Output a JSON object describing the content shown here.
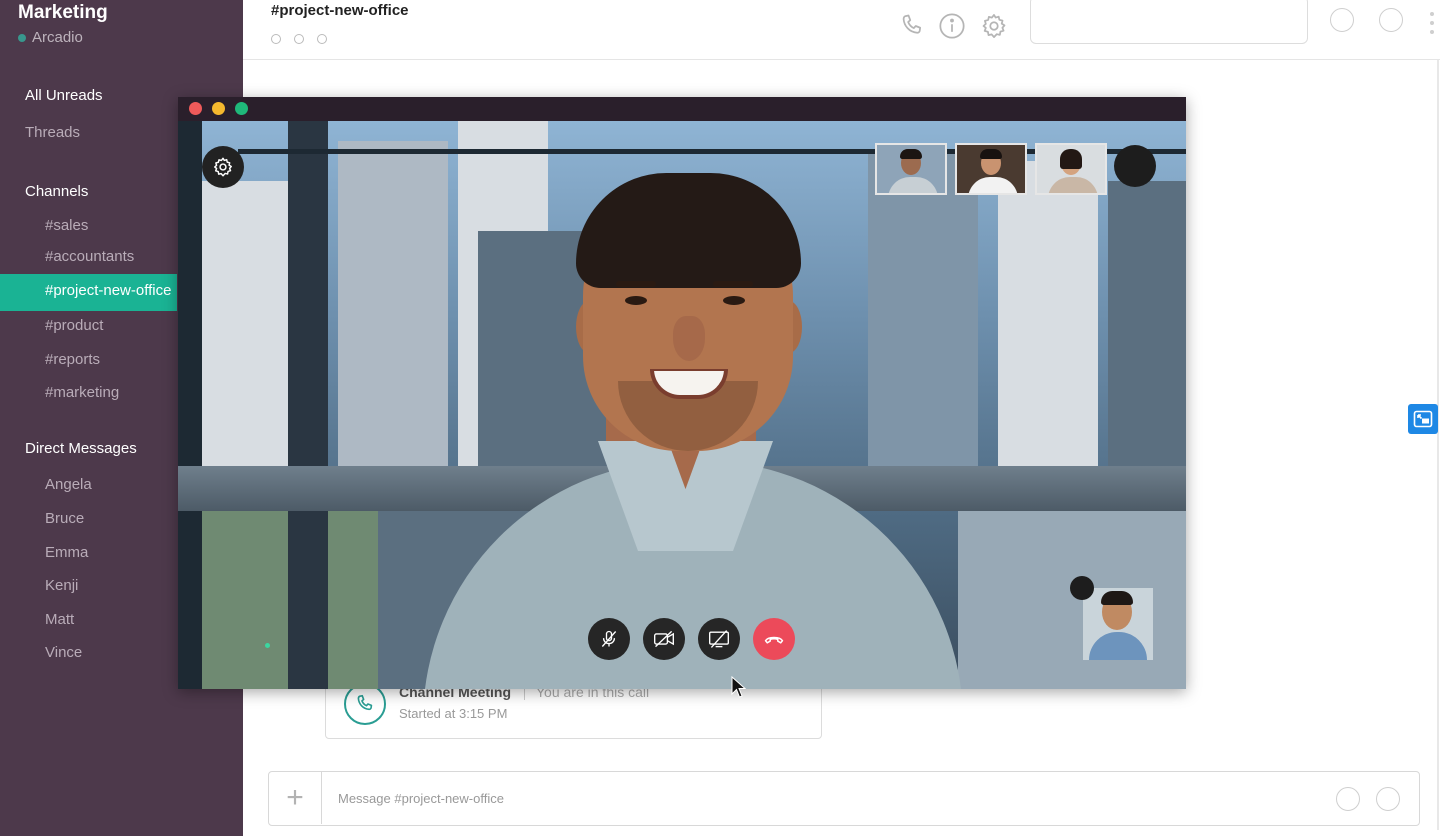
{
  "workspace": {
    "team_name": "Marketing",
    "user_name": "Arcadio"
  },
  "sidebar": {
    "all_unreads": "All Unreads",
    "threads": "Threads",
    "channels_heading": "Channels",
    "channels": [
      "#sales",
      "#accountants",
      "#project-new-office",
      "#product",
      "#reports",
      "#marketing"
    ],
    "active_channel": "#project-new-office",
    "dm_heading": "Direct Messages",
    "direct_messages": [
      "Angela",
      "Bruce",
      "Emma",
      "Kenji",
      "Matt",
      "Vince"
    ]
  },
  "header": {
    "channel_title": "#project-new-office"
  },
  "meeting": {
    "title": "Channel Meeting",
    "status": "You are in this call",
    "started": "Started at 3:15 PM"
  },
  "composer": {
    "placeholder": "Message #project-new-office"
  },
  "colors": {
    "sidebar_bg": "#4d394b",
    "active_channel_bg": "#1ab394",
    "end_call": "#ec4a5a",
    "presence": "#38978d",
    "float_button": "#1e88e5"
  },
  "icons": {
    "header": [
      "phone-icon",
      "info-icon",
      "gear-icon"
    ],
    "call_controls": [
      "mic-off-icon",
      "video-off-icon",
      "screen-share-off-icon",
      "end-call-icon"
    ]
  }
}
